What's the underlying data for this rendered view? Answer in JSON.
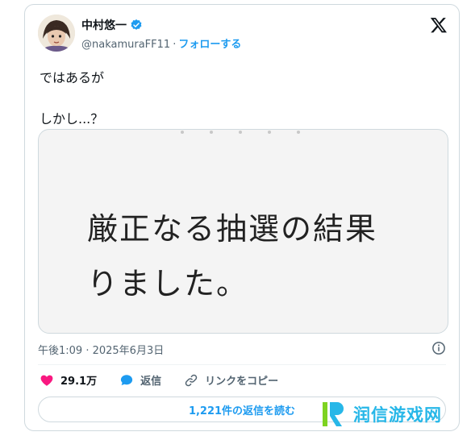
{
  "header": {
    "display_name": "中村悠一",
    "handle": "@nakamuraFF11",
    "separator": "·",
    "follow_label": "フォローする"
  },
  "tweet": {
    "line1": "ではあるが",
    "line2": "しかし...？"
  },
  "media": {
    "line1": "厳正なる抽選の結果",
    "line2": "りました。"
  },
  "meta": {
    "timestamp": "午後1:09 · 2025年6月3日"
  },
  "actions": {
    "like_count": "29.1万",
    "reply_label": "返信",
    "copy_link_label": "リンクをコピー"
  },
  "replies_button": "1,221件の返信を読む",
  "watermark": {
    "text": "润信游戏网"
  },
  "colors": {
    "accent": "#1d9bf0",
    "like": "#f91880",
    "secondary_text": "#536471",
    "border": "#cfd9de",
    "watermark": "#27b7e8"
  },
  "icons": [
    "avatar",
    "verified-badge-icon",
    "x-logo-icon",
    "info-icon",
    "heart-icon",
    "reply-bubble-icon",
    "link-icon",
    "watermark-logo"
  ]
}
